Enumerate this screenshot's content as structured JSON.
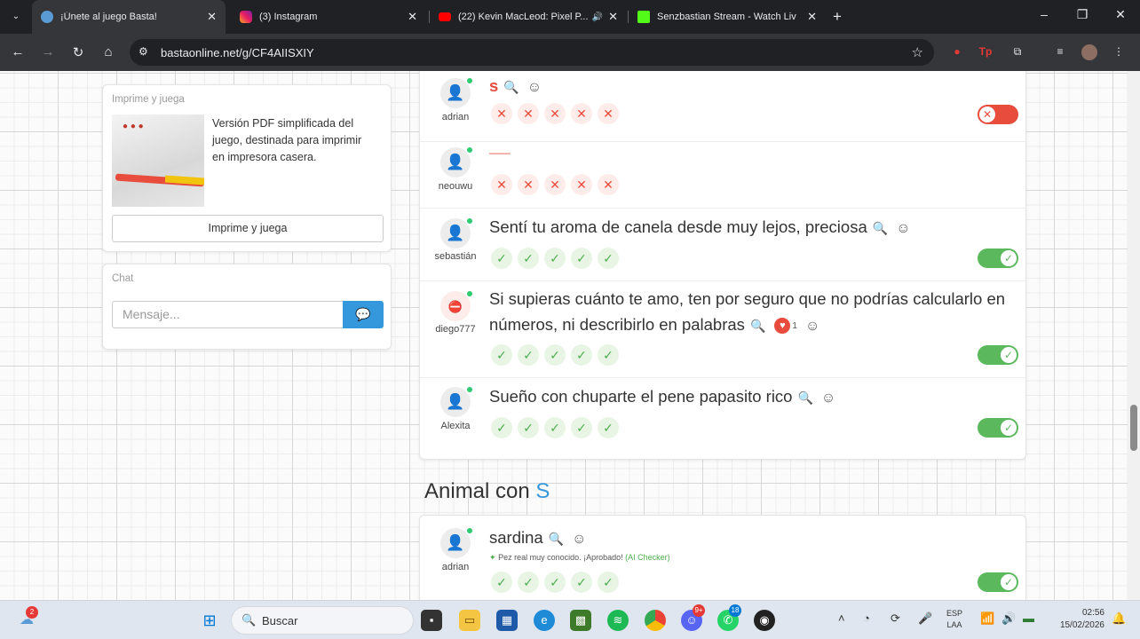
{
  "tabs": [
    {
      "title": "¡Únete al juego Basta!",
      "close": "✕"
    },
    {
      "title": "(3) Instagram",
      "close": "✕"
    },
    {
      "title": "(22) Kevin MacLeod: Pixel P...",
      "close": "✕"
    },
    {
      "title": "Senzbastian Stream - Watch Liv",
      "close": "✕"
    }
  ],
  "toolbar": {
    "url": "bastaonline.net/g/CF4AIISXIY"
  },
  "sidebar": {
    "print_card": {
      "title": "Imprime y juega",
      "description": "Versión PDF simplificada del juego, destinada para imprimir en impresora casera.",
      "button": "Imprime y juega"
    },
    "chat": {
      "title": "Chat",
      "placeholder": "Mensaje..."
    }
  },
  "answers": [
    {
      "user": "adrian",
      "answer": "s",
      "marks": [
        "x",
        "x",
        "x",
        "x",
        "x"
      ],
      "valid": false
    },
    {
      "user": "neouwu",
      "answer": "——",
      "marks": [
        "x",
        "x",
        "x",
        "x",
        "x"
      ]
    },
    {
      "user": "sebastián",
      "answer": "Sentí tu aroma de canela desde muy lejos, preciosa",
      "marks": [
        "check",
        "check",
        "check",
        "check",
        "check"
      ],
      "valid": true
    },
    {
      "user": "diego777",
      "answer_line1": "Si supieras cuánto te amo, ten por seguro que no podrías calcularlo en",
      "answer_line2": "números, ni describirlo en palabras",
      "likes": "1",
      "marks": [
        "check",
        "check",
        "check",
        "check",
        "check"
      ],
      "valid": true
    },
    {
      "user": "Alexita",
      "answer": "Sueño con chuparte el pene papasito rico",
      "marks": [
        "check",
        "check",
        "check",
        "check",
        "check"
      ],
      "valid": true
    }
  ],
  "section": {
    "title": "Animal con ",
    "letter": "S"
  },
  "animal_answers": [
    {
      "user": "adrian",
      "answer": "sardina",
      "ai_note": "Pez real muy conocido. ¡Aprobado!",
      "ai_label": "(AI Checker)",
      "marks": [
        "check",
        "check",
        "check",
        "check",
        "check"
      ],
      "valid": true
    }
  ],
  "taskbar": {
    "search_placeholder": "Buscar",
    "lang_top": "ESP",
    "lang_bottom": "LAA",
    "time": "02:56",
    "date": "15/02/2026",
    "widget_badge": "2",
    "discord_badge": "9+",
    "whatsapp_badge": "18"
  },
  "colors": {
    "accent": "#3598dc",
    "valid": "#5cb85c",
    "invalid": "#e74c3c"
  }
}
